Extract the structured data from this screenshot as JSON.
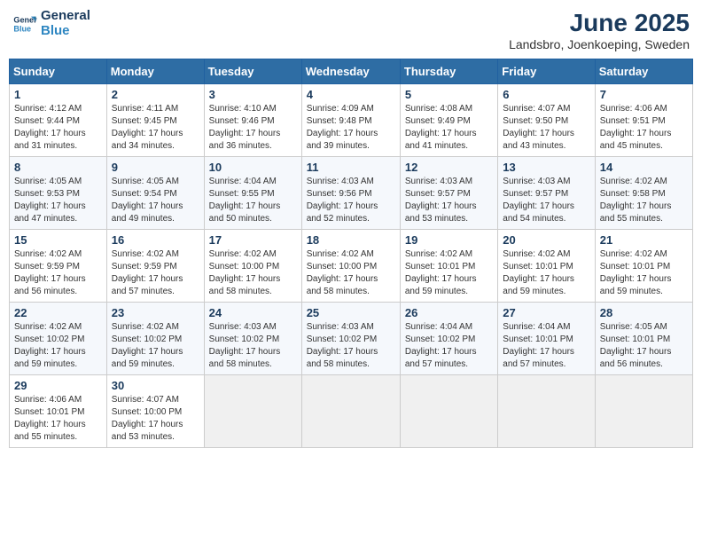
{
  "logo": {
    "line1": "General",
    "line2": "Blue"
  },
  "title": "June 2025",
  "subtitle": "Landsbro, Joenkoeping, Sweden",
  "headers": [
    "Sunday",
    "Monday",
    "Tuesday",
    "Wednesday",
    "Thursday",
    "Friday",
    "Saturday"
  ],
  "weeks": [
    [
      {
        "day": "1",
        "info": "Sunrise: 4:12 AM\nSunset: 9:44 PM\nDaylight: 17 hours\nand 31 minutes."
      },
      {
        "day": "2",
        "info": "Sunrise: 4:11 AM\nSunset: 9:45 PM\nDaylight: 17 hours\nand 34 minutes."
      },
      {
        "day": "3",
        "info": "Sunrise: 4:10 AM\nSunset: 9:46 PM\nDaylight: 17 hours\nand 36 minutes."
      },
      {
        "day": "4",
        "info": "Sunrise: 4:09 AM\nSunset: 9:48 PM\nDaylight: 17 hours\nand 39 minutes."
      },
      {
        "day": "5",
        "info": "Sunrise: 4:08 AM\nSunset: 9:49 PM\nDaylight: 17 hours\nand 41 minutes."
      },
      {
        "day": "6",
        "info": "Sunrise: 4:07 AM\nSunset: 9:50 PM\nDaylight: 17 hours\nand 43 minutes."
      },
      {
        "day": "7",
        "info": "Sunrise: 4:06 AM\nSunset: 9:51 PM\nDaylight: 17 hours\nand 45 minutes."
      }
    ],
    [
      {
        "day": "8",
        "info": "Sunrise: 4:05 AM\nSunset: 9:53 PM\nDaylight: 17 hours\nand 47 minutes."
      },
      {
        "day": "9",
        "info": "Sunrise: 4:05 AM\nSunset: 9:54 PM\nDaylight: 17 hours\nand 49 minutes."
      },
      {
        "day": "10",
        "info": "Sunrise: 4:04 AM\nSunset: 9:55 PM\nDaylight: 17 hours\nand 50 minutes."
      },
      {
        "day": "11",
        "info": "Sunrise: 4:03 AM\nSunset: 9:56 PM\nDaylight: 17 hours\nand 52 minutes."
      },
      {
        "day": "12",
        "info": "Sunrise: 4:03 AM\nSunset: 9:57 PM\nDaylight: 17 hours\nand 53 minutes."
      },
      {
        "day": "13",
        "info": "Sunrise: 4:03 AM\nSunset: 9:57 PM\nDaylight: 17 hours\nand 54 minutes."
      },
      {
        "day": "14",
        "info": "Sunrise: 4:02 AM\nSunset: 9:58 PM\nDaylight: 17 hours\nand 55 minutes."
      }
    ],
    [
      {
        "day": "15",
        "info": "Sunrise: 4:02 AM\nSunset: 9:59 PM\nDaylight: 17 hours\nand 56 minutes."
      },
      {
        "day": "16",
        "info": "Sunrise: 4:02 AM\nSunset: 9:59 PM\nDaylight: 17 hours\nand 57 minutes."
      },
      {
        "day": "17",
        "info": "Sunrise: 4:02 AM\nSunset: 10:00 PM\nDaylight: 17 hours\nand 58 minutes."
      },
      {
        "day": "18",
        "info": "Sunrise: 4:02 AM\nSunset: 10:00 PM\nDaylight: 17 hours\nand 58 minutes."
      },
      {
        "day": "19",
        "info": "Sunrise: 4:02 AM\nSunset: 10:01 PM\nDaylight: 17 hours\nand 59 minutes."
      },
      {
        "day": "20",
        "info": "Sunrise: 4:02 AM\nSunset: 10:01 PM\nDaylight: 17 hours\nand 59 minutes."
      },
      {
        "day": "21",
        "info": "Sunrise: 4:02 AM\nSunset: 10:01 PM\nDaylight: 17 hours\nand 59 minutes."
      }
    ],
    [
      {
        "day": "22",
        "info": "Sunrise: 4:02 AM\nSunset: 10:02 PM\nDaylight: 17 hours\nand 59 minutes."
      },
      {
        "day": "23",
        "info": "Sunrise: 4:02 AM\nSunset: 10:02 PM\nDaylight: 17 hours\nand 59 minutes."
      },
      {
        "day": "24",
        "info": "Sunrise: 4:03 AM\nSunset: 10:02 PM\nDaylight: 17 hours\nand 58 minutes."
      },
      {
        "day": "25",
        "info": "Sunrise: 4:03 AM\nSunset: 10:02 PM\nDaylight: 17 hours\nand 58 minutes."
      },
      {
        "day": "26",
        "info": "Sunrise: 4:04 AM\nSunset: 10:02 PM\nDaylight: 17 hours\nand 57 minutes."
      },
      {
        "day": "27",
        "info": "Sunrise: 4:04 AM\nSunset: 10:01 PM\nDaylight: 17 hours\nand 57 minutes."
      },
      {
        "day": "28",
        "info": "Sunrise: 4:05 AM\nSunset: 10:01 PM\nDaylight: 17 hours\nand 56 minutes."
      }
    ],
    [
      {
        "day": "29",
        "info": "Sunrise: 4:06 AM\nSunset: 10:01 PM\nDaylight: 17 hours\nand 55 minutes."
      },
      {
        "day": "30",
        "info": "Sunrise: 4:07 AM\nSunset: 10:00 PM\nDaylight: 17 hours\nand 53 minutes."
      },
      {
        "day": "",
        "info": ""
      },
      {
        "day": "",
        "info": ""
      },
      {
        "day": "",
        "info": ""
      },
      {
        "day": "",
        "info": ""
      },
      {
        "day": "",
        "info": ""
      }
    ]
  ]
}
